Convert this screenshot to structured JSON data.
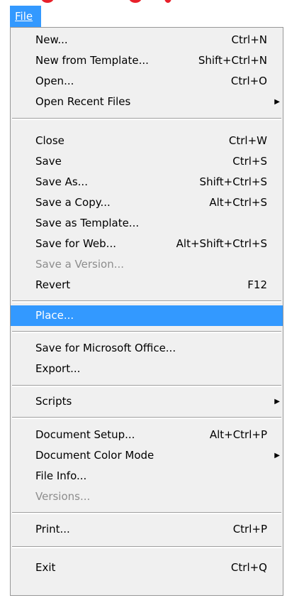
{
  "menubar": {
    "file_label": "File"
  },
  "menu": {
    "items": [
      {
        "label": "New...",
        "shortcut": "Ctrl+N"
      },
      {
        "label": "New from Template...",
        "shortcut": "Shift+Ctrl+N"
      },
      {
        "label": "Open...",
        "shortcut": "Ctrl+O"
      },
      {
        "label": "Open Recent Files",
        "shortcut": "",
        "submenu": true
      },
      {
        "label": "Close",
        "shortcut": "Ctrl+W"
      },
      {
        "label": "Save",
        "shortcut": "Ctrl+S"
      },
      {
        "label": "Save As...",
        "shortcut": "Shift+Ctrl+S"
      },
      {
        "label": "Save a Copy...",
        "shortcut": "Alt+Ctrl+S"
      },
      {
        "label": "Save as Template...",
        "shortcut": ""
      },
      {
        "label": "Save for Web...",
        "shortcut": "Alt+Shift+Ctrl+S"
      },
      {
        "label": "Save a Version...",
        "shortcut": "",
        "disabled": true
      },
      {
        "label": "Revert",
        "shortcut": "F12"
      },
      {
        "label": "Place...",
        "shortcut": "",
        "highlighted": true
      },
      {
        "label": "Save for Microsoft Office...",
        "shortcut": ""
      },
      {
        "label": "Export...",
        "shortcut": ""
      },
      {
        "label": "Scripts",
        "shortcut": "",
        "submenu": true
      },
      {
        "label": "Document Setup...",
        "shortcut": "Alt+Ctrl+P"
      },
      {
        "label": "Document Color Mode",
        "shortcut": "",
        "submenu": true
      },
      {
        "label": "File Info...",
        "shortcut": ""
      },
      {
        "label": "Versions...",
        "shortcut": "",
        "disabled": true
      },
      {
        "label": "Print...",
        "shortcut": "Ctrl+P"
      },
      {
        "label": "Exit",
        "shortcut": "Ctrl+Q"
      }
    ],
    "submenu_arrow": "▶"
  },
  "colors": {
    "highlight": "#3399ff",
    "menu_background": "#f0f0f0",
    "disabled_text": "#8d8d8d"
  }
}
